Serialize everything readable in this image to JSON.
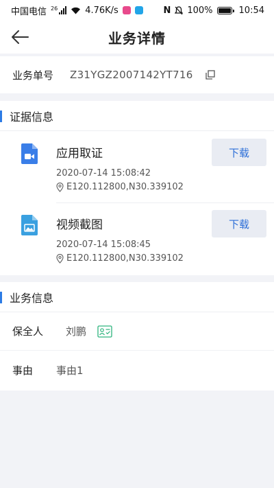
{
  "status_bar": {
    "carrier": "中国电信",
    "network": "26",
    "speed": "4.76K/s",
    "nfc": "N",
    "battery": "100%",
    "time": "10:54"
  },
  "nav": {
    "title": "业务详情"
  },
  "order": {
    "label": "业务单号",
    "value": "Z31YGZ2007142YT716"
  },
  "evidence": {
    "title": "证据信息",
    "items": [
      {
        "title": "应用取证",
        "time": "2020-07-14 15:08:42",
        "location": "E120.112800,N30.339102",
        "icon": "video-file-icon",
        "download_label": "下载"
      },
      {
        "title": "视频截图",
        "time": "2020-07-14 15:08:45",
        "location": "E120.112800,N30.339102",
        "icon": "image-file-icon",
        "download_label": "下载"
      }
    ]
  },
  "business": {
    "title": "业务信息",
    "rows": [
      {
        "label": "保全人",
        "value": "刘鹏"
      },
      {
        "label": "事由",
        "value": "事由1"
      }
    ]
  },
  "colors": {
    "accent": "#2d7be5",
    "video_icon": "#3a7ee8",
    "image_icon": "#3aa0e0",
    "id_card_icon": "#2db37d"
  }
}
